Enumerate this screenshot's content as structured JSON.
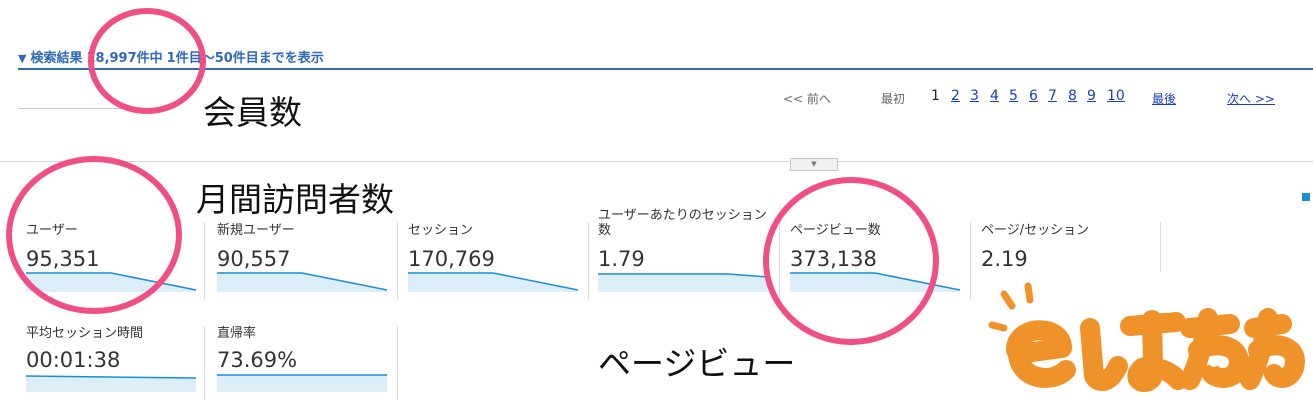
{
  "search": {
    "toggle_icon": "triangle-down-icon",
    "label": "検索結果",
    "count": "18,997件中",
    "range": "1件目～50件目までを表示"
  },
  "pagination": {
    "prev": "<< 前へ",
    "first": "最初",
    "current": "1",
    "pages": [
      "2",
      "3",
      "4",
      "5",
      "6",
      "7",
      "8",
      "9",
      "10"
    ],
    "last": "最後",
    "next": "次へ >>"
  },
  "annotations": {
    "members": "会員数",
    "visitors": "月間訪問者数",
    "pageviews": "ページビュー"
  },
  "metrics": [
    {
      "label": "ユーザー",
      "value": "95,351"
    },
    {
      "label": "新規ユーザー",
      "value": "90,557"
    },
    {
      "label": "セッション",
      "value": "170,769"
    },
    {
      "label": "ユーザーあたりのセッション",
      "label2": "数",
      "value": "1.79"
    },
    {
      "label": "ページビュー数",
      "value": "373,138"
    },
    {
      "label": "ページ/セッション",
      "value": "2.19"
    },
    {
      "label": "平均セッション時間",
      "value": "00:01:38"
    },
    {
      "label": "直帰率",
      "value": "73.69%"
    }
  ],
  "colors": {
    "link": "#1a3dc1",
    "header_blue": "#2f6ab8",
    "sparkline": "#1a8cd8",
    "sparkline_fill": "#dceff9",
    "highlight_circle": "#ef4f86",
    "logo_orange": "#f0922a"
  },
  "logo": {
    "text": "eしずおか",
    "icon": "eshizuoka-logo"
  }
}
